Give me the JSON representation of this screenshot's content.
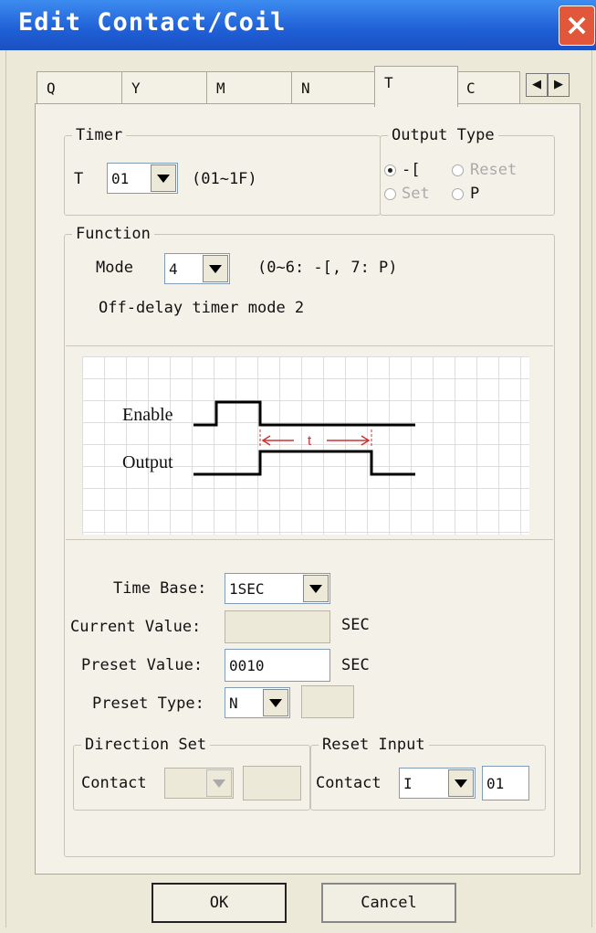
{
  "window": {
    "title": "Edit Contact/Coil",
    "close_icon": "×"
  },
  "tabs": [
    {
      "label": "Q"
    },
    {
      "label": "Y"
    },
    {
      "label": "M"
    },
    {
      "label": "N"
    },
    {
      "label": "T"
    },
    {
      "label": "C"
    }
  ],
  "active_tab": "T",
  "tab_scroll": {
    "left": "◀",
    "right": "▶"
  },
  "timer": {
    "legend": "Timer",
    "prefix": "T",
    "value": "01",
    "range": "(01~1F)"
  },
  "output_type": {
    "legend": "Output Type",
    "options": [
      {
        "label": "-[",
        "selected": true,
        "enabled": true
      },
      {
        "label": "Reset",
        "selected": false,
        "enabled": false
      },
      {
        "label": "Set",
        "selected": false,
        "enabled": false
      },
      {
        "label": "P",
        "selected": false,
        "enabled": true
      }
    ]
  },
  "function": {
    "legend": "Function",
    "mode_label": "Mode",
    "mode_value": "4",
    "mode_range": "(0~6: -[, 7: P)",
    "description": "Off-delay timer mode 2"
  },
  "diagram": {
    "enable_label": "Enable",
    "output_label": "Output",
    "t_label": "t"
  },
  "time_base": {
    "label": "Time Base:",
    "value": "1SEC"
  },
  "current_value": {
    "label": "Current Value:",
    "value": "",
    "unit": "SEC"
  },
  "preset_value": {
    "label": "Preset Value:",
    "value": "0010",
    "unit": "SEC"
  },
  "preset_type": {
    "label": "Preset Type:",
    "value": "N",
    "extra": ""
  },
  "direction_set": {
    "legend": "Direction Set",
    "contact_label": "Contact",
    "value": "",
    "extra": ""
  },
  "reset_input": {
    "legend": "Reset Input",
    "contact_label": "Contact",
    "value": "I",
    "number": "01"
  },
  "buttons": {
    "ok": "OK",
    "cancel": "Cancel"
  },
  "colors": {
    "titlebar": "#1f5fd6",
    "close": "#e2563a",
    "timing_line": "#000000",
    "annotation": "#d03030"
  }
}
